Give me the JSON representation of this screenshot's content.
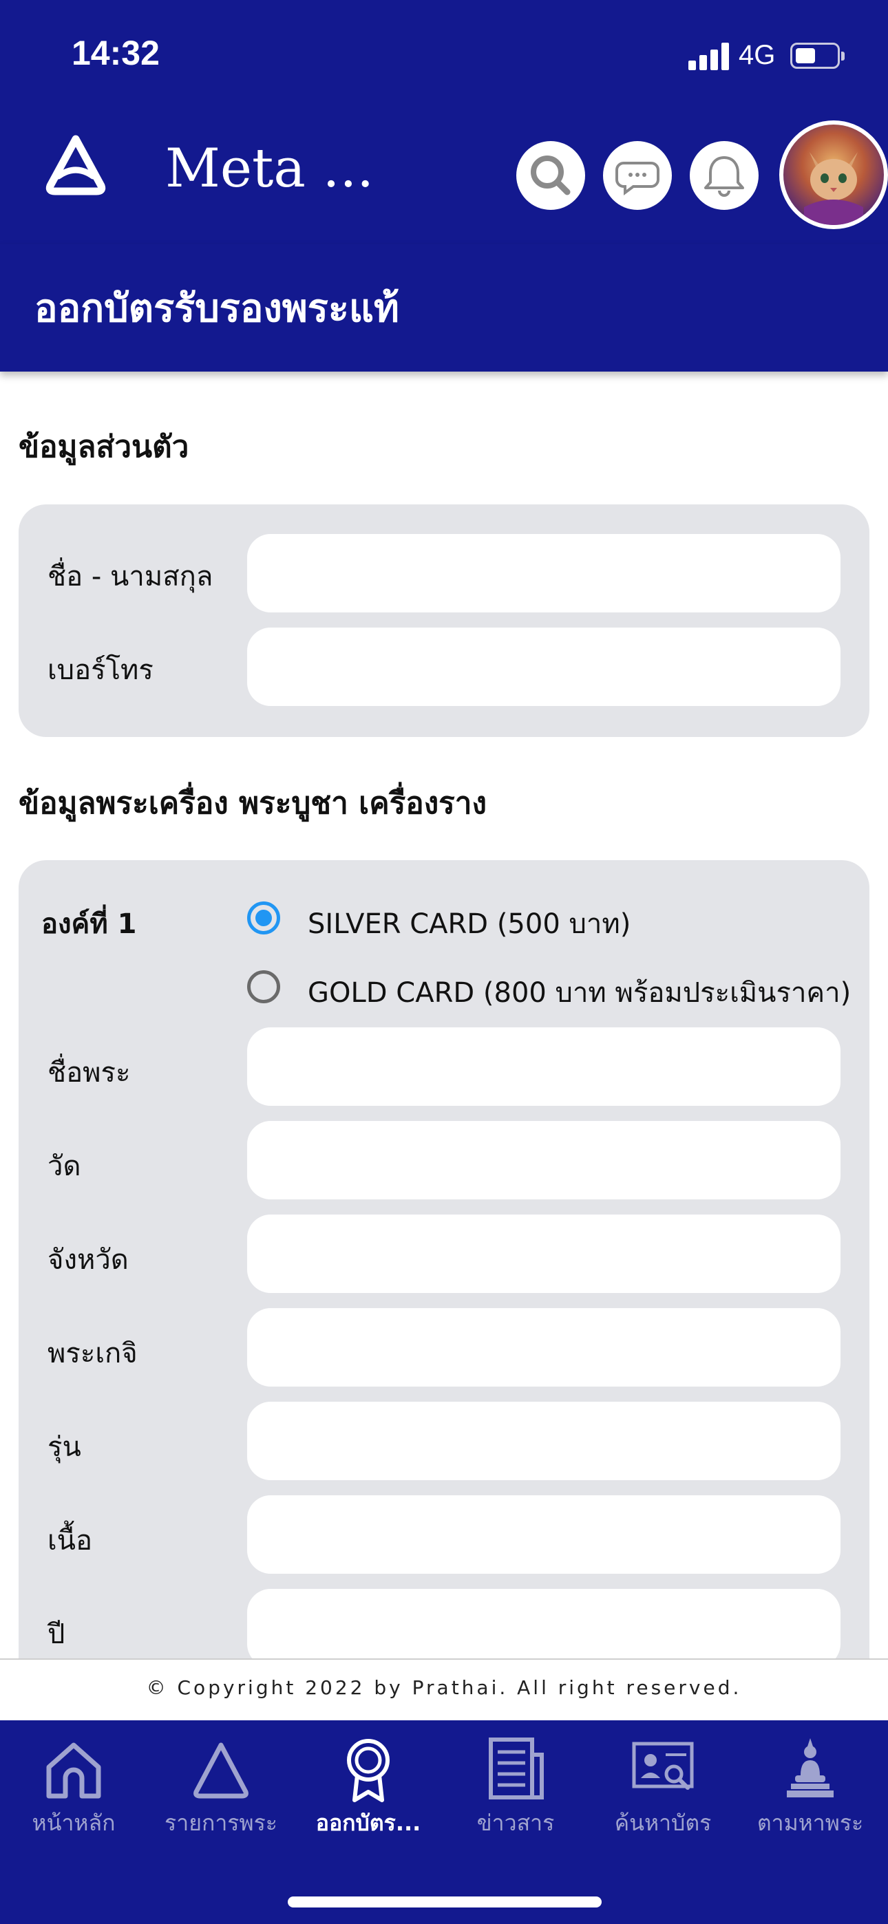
{
  "status_bar": {
    "time": "14:32",
    "network": "4G"
  },
  "header": {
    "app_title": "Meta ..."
  },
  "page": {
    "title": "ออกบัตรรับรองพระแท้"
  },
  "personal": {
    "heading": "ข้อมูลส่วนตัว",
    "fields": [
      {
        "label": "ชื่อ - นามสกุล",
        "value": ""
      },
      {
        "label": "เบอร์โทร",
        "value": ""
      }
    ]
  },
  "amulet": {
    "heading": "ข้อมูลพระเครื่อง พระบูชา เครื่องราง",
    "item_label": "องค์ที่ 1",
    "options": [
      {
        "label": "SILVER CARD (500 บาท)",
        "selected": true
      },
      {
        "label": "GOLD CARD (800 บาท พร้อมประเมินราคา)",
        "selected": false
      }
    ],
    "fields": [
      {
        "label": "ชื่อพระ",
        "value": ""
      },
      {
        "label": "วัด",
        "value": ""
      },
      {
        "label": "จังหวัด",
        "value": ""
      },
      {
        "label": "พระเกจิ",
        "value": ""
      },
      {
        "label": "รุ่น",
        "value": ""
      },
      {
        "label": "เนื้อ",
        "value": ""
      },
      {
        "label": "ปี",
        "value": ""
      }
    ]
  },
  "footer": {
    "copyright": "© Copyright 2022 by Prathai. All right reserved."
  },
  "nav": {
    "items": [
      {
        "label": "หน้าหลัก",
        "icon": "home-icon"
      },
      {
        "label": "รายการพระ",
        "icon": "triangle-icon"
      },
      {
        "label": "ออกบัตร...",
        "icon": "badge-icon",
        "active": true
      },
      {
        "label": "ข่าวสาร",
        "icon": "news-icon"
      },
      {
        "label": "ค้นหาบัตร",
        "icon": "card-search-icon"
      },
      {
        "label": "ตามหาพระ",
        "icon": "buddha-icon"
      }
    ]
  },
  "colors": {
    "primary": "#13198f",
    "panel": "#e3e4e8",
    "radio_selected": "#2196f3"
  }
}
